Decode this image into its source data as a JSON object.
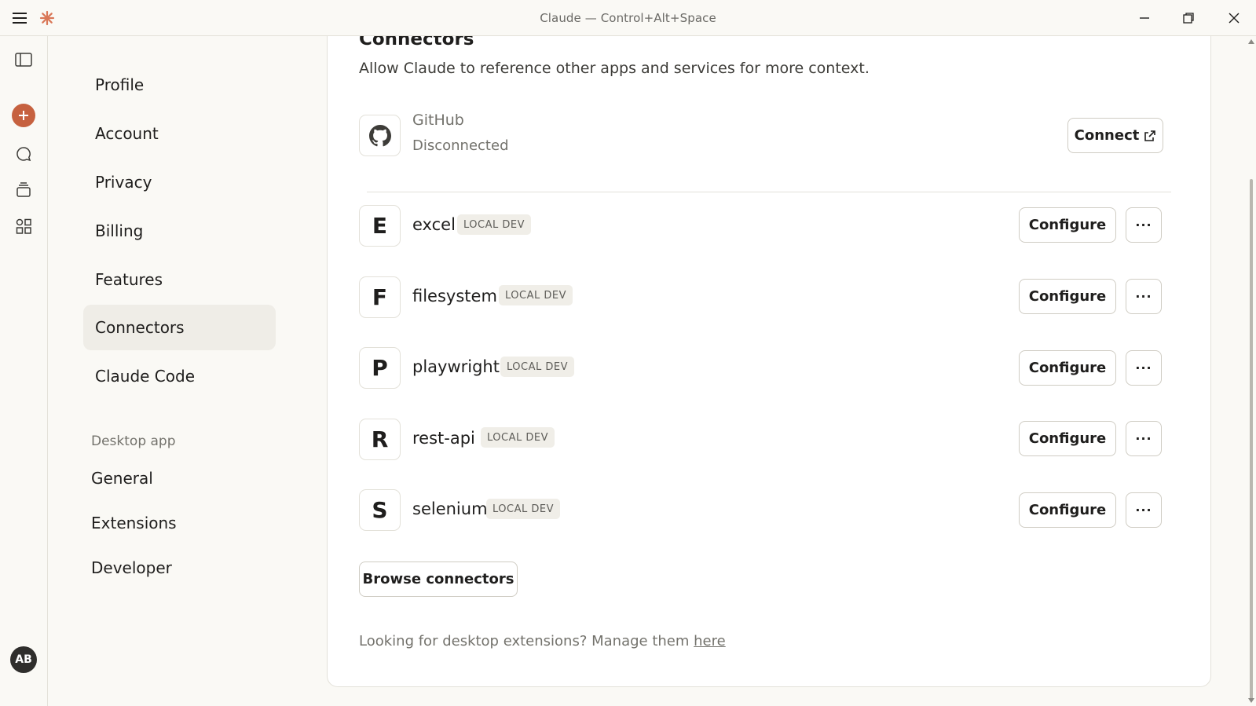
{
  "window": {
    "title": "Claude — Control+Alt+Space"
  },
  "rail": {
    "avatar_initials": "AB"
  },
  "nav": {
    "items": [
      {
        "label": "Profile"
      },
      {
        "label": "Account"
      },
      {
        "label": "Privacy"
      },
      {
        "label": "Billing"
      },
      {
        "label": "Features"
      },
      {
        "label": "Connectors"
      },
      {
        "label": "Claude Code"
      }
    ],
    "active": "Connectors",
    "desktop_section": "Desktop app",
    "desktop_items": [
      {
        "label": "General"
      },
      {
        "label": "Extensions"
      },
      {
        "label": "Developer"
      }
    ]
  },
  "main": {
    "heading": "Connectors",
    "description": "Allow Claude to reference other apps and services for more context.",
    "github": {
      "name": "GitHub",
      "status": "Disconnected",
      "button": "Connect"
    },
    "connectors": [
      {
        "letter": "E",
        "name": "excel",
        "badge": "LOCAL DEV",
        "button": "Configure",
        "more": "···"
      },
      {
        "letter": "F",
        "name": "filesystem",
        "badge": "LOCAL DEV",
        "button": "Configure",
        "more": "···"
      },
      {
        "letter": "P",
        "name": "playwright",
        "badge": "LOCAL DEV",
        "button": "Configure",
        "more": "···"
      },
      {
        "letter": "R",
        "name": "rest-api",
        "badge": "LOCAL DEV",
        "button": "Configure",
        "more": "···"
      },
      {
        "letter": "S",
        "name": "selenium",
        "badge": "LOCAL DEV",
        "button": "Configure",
        "more": "···"
      }
    ],
    "browse_button": "Browse connectors",
    "footer_text": "Looking for desktop extensions? Manage them ",
    "footer_link": "here"
  },
  "colors": {
    "accent": "#c6613f",
    "background": "#faf9f5",
    "active_nav": "#efede7"
  }
}
